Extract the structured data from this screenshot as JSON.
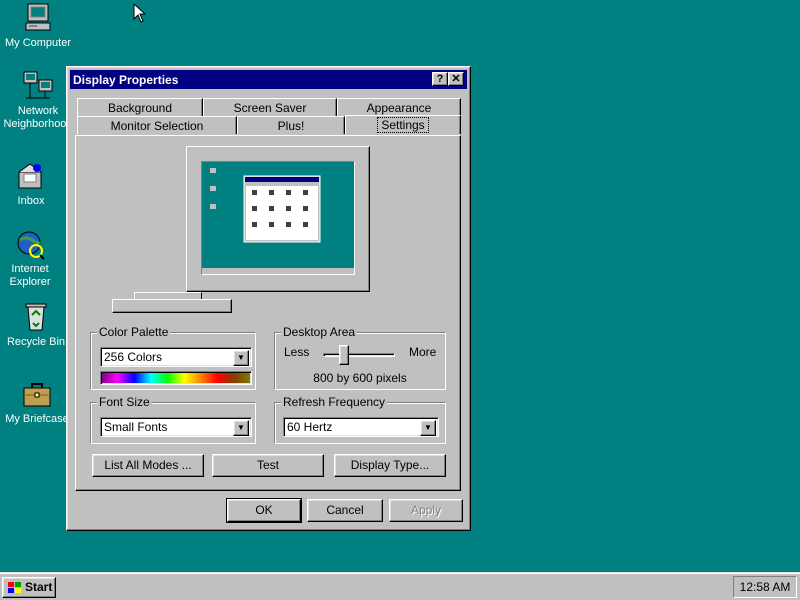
{
  "desktop": {
    "icons": [
      {
        "label": "My Computer"
      },
      {
        "label_line1": "Network",
        "label_line2": "Neighborhood"
      },
      {
        "label": "Inbox"
      },
      {
        "label_line1": "Internet",
        "label_line2": "Explorer"
      },
      {
        "label": "Recycle Bin"
      },
      {
        "label": "My Briefcase"
      }
    ]
  },
  "window": {
    "title": "Display Properties",
    "help_glyph": "?",
    "close_glyph": "✕",
    "tabs_back": [
      "Background",
      "Screen Saver",
      "Appearance"
    ],
    "tabs_front": [
      "Monitor Selection",
      "Plus!",
      "Settings"
    ],
    "active_tab": "Settings",
    "color_palette": {
      "label": "Color Palette",
      "value": "256 Colors"
    },
    "desktop_area": {
      "label": "Desktop Area",
      "less": "Less",
      "more": "More",
      "slider_fraction": 0.25,
      "resolution": "800 by 600 pixels"
    },
    "font_size": {
      "label": "Font Size",
      "value": "Small Fonts"
    },
    "refresh": {
      "label": "Refresh Frequency",
      "value": "60 Hertz"
    },
    "buttons": {
      "list_modes": "List All Modes ...",
      "test": "Test",
      "display_type": "Display Type...",
      "ok": "OK",
      "cancel": "Cancel",
      "apply": "Apply"
    }
  },
  "taskbar": {
    "start": "Start",
    "clock": "12:58 AM"
  },
  "colors": {
    "desktop": "#008080",
    "titlebar": "#000080",
    "face": "#c0c0c0"
  }
}
